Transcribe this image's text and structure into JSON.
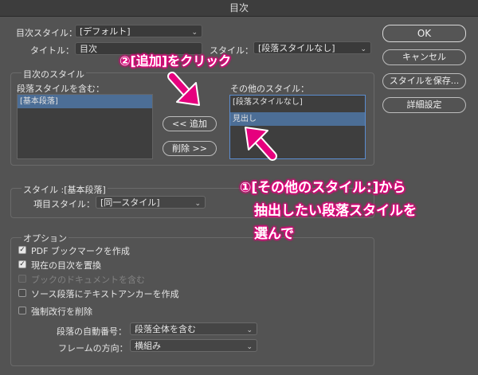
{
  "window": {
    "title": "目次"
  },
  "toc_style": {
    "label": "目次スタイル：",
    "value": "[デフォルト]"
  },
  "title_row": {
    "label": "タイトル：",
    "value": "目次",
    "style_label": "スタイル：",
    "style_value": "[段落スタイルなし]"
  },
  "toc_styles_group": {
    "label": "目次のスタイル",
    "include_label": "段落スタイルを含む：",
    "include_items": [
      "[基本段落]"
    ],
    "other_label": "その他のスタイル：",
    "other_items": [
      "[段落スタイルなし]",
      "見出し"
    ],
    "add_button": "<< 追加",
    "remove_button": "削除 >>"
  },
  "style_group": {
    "label": "スタイル :[基本段落]",
    "entry_label": "項目スタイル：",
    "entry_value": "[同一スタイル]"
  },
  "options": {
    "label": "オプション",
    "checkboxes": [
      {
        "label": "PDF ブックマークを作成",
        "checked": true,
        "disabled": false
      },
      {
        "label": "現在の目次を置換",
        "checked": true,
        "disabled": false
      },
      {
        "label": "ブックのドキュメントを含む",
        "checked": false,
        "disabled": true
      },
      {
        "label": "ソース段落にテキストアンカーを作成",
        "checked": false,
        "disabled": false
      },
      {
        "label": "強制改行を削除",
        "checked": false,
        "disabled": false
      }
    ],
    "numbering_label": "段落の自動番号：",
    "numbering_value": "段落全体を含む",
    "frame_label": "フレームの方向：",
    "frame_value": "横組み"
  },
  "side_buttons": {
    "ok": "OK",
    "cancel": "キャンセル",
    "save_style": "スタイルを保存...",
    "more": "詳細設定"
  },
  "annotations": {
    "step2": "②[追加]をクリック",
    "step1_line1": "①[その他のスタイル：]から",
    "step1_line2": "抽出したい段落スタイルを",
    "step1_line3": "選んで"
  },
  "colors": {
    "annotation_accent": "#e6007e",
    "selection": "#4c6e96",
    "background": "#535353"
  },
  "icons": {
    "arrow": "arrow-down-right-icon",
    "arrow2": "arrow-up-left-icon",
    "chevron": "chevron-down-icon"
  }
}
